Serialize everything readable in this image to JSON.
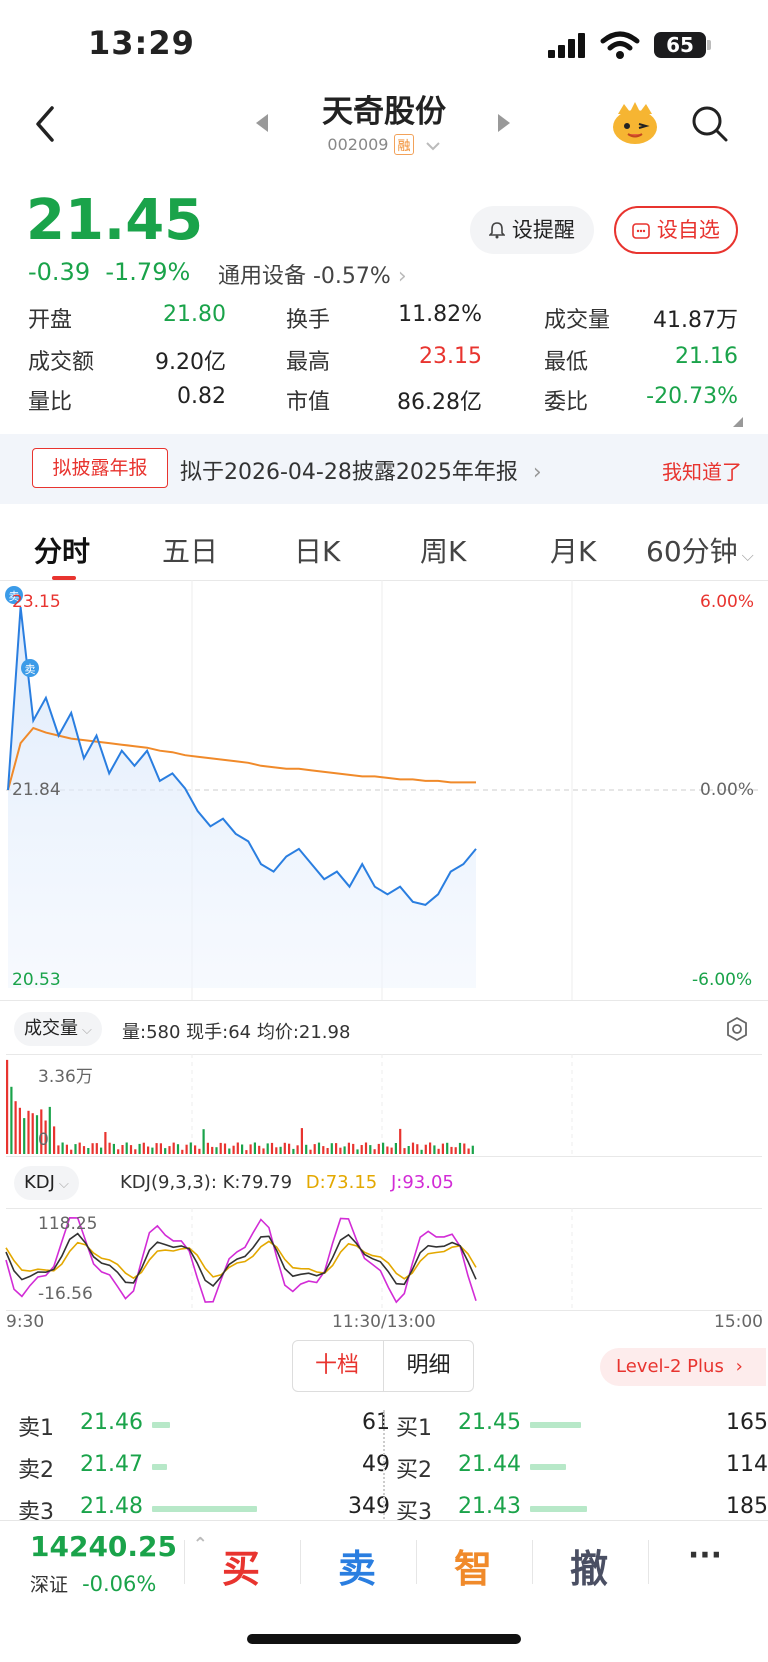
{
  "status": {
    "time": "13:29",
    "battery": "65"
  },
  "header": {
    "title": "天奇股份",
    "code": "002009",
    "tag": "融"
  },
  "quote": {
    "price": "21.45",
    "change": "-0.39",
    "change_pct": "-1.79%",
    "sector": "通用设备 -0.57%",
    "alert_btn": "设提醒",
    "watch_btn": "设自选"
  },
  "stats": [
    {
      "label": "开盘",
      "value": "21.80",
      "color": "#1aa34a"
    },
    {
      "label": "换手",
      "value": "11.82%",
      "color": "#222222"
    },
    {
      "label": "成交量",
      "value": "41.87万",
      "color": "#222222"
    },
    {
      "label": "成交额",
      "value": "9.20亿",
      "color": "#222222"
    },
    {
      "label": "最高",
      "value": "23.15",
      "color": "#e8342f"
    },
    {
      "label": "最低",
      "value": "21.16",
      "color": "#1aa34a"
    },
    {
      "label": "量比",
      "value": "0.82",
      "color": "#222222"
    },
    {
      "label": "市值",
      "value": "86.28亿",
      "color": "#222222"
    },
    {
      "label": "委比",
      "value": "-20.73%",
      "color": "#1aa34a"
    }
  ],
  "notice": {
    "tag": "拟披露年报",
    "text": "拟于2026-04-28披露2025年年报",
    "dismiss": "我知道了"
  },
  "tabs": [
    "分时",
    "五日",
    "日K",
    "周K",
    "月K",
    "60分钟"
  ],
  "chart": {
    "price_high": "23.15",
    "price_mid": "21.84",
    "price_low": "20.53",
    "pct_high": "6.00%",
    "pct_mid": "0.00%",
    "pct_low": "-6.00%",
    "sell_marker": "卖"
  },
  "chart_data": {
    "type": "line",
    "title": "",
    "ylim": [
      20.53,
      23.15
    ],
    "prev_close": 21.84,
    "series": [
      {
        "values": [
          21.84,
          23.05,
          22.3,
          22.45,
          22.2,
          22.35,
          22.05,
          22.2,
          21.95,
          22.1,
          22.0,
          22.1,
          21.9,
          21.95,
          21.85,
          21.7,
          21.6,
          21.65,
          21.55,
          21.5,
          21.35,
          21.3,
          21.4,
          21.45,
          21.35,
          21.25,
          21.3,
          21.2,
          21.35,
          21.2,
          21.15,
          21.2,
          21.1,
          21.08,
          21.15,
          21.3,
          21.35,
          21.45
        ]
      },
      {
        "values": [
          21.84,
          22.15,
          22.25,
          22.22,
          22.2,
          22.18,
          22.17,
          22.16,
          22.15,
          22.14,
          22.13,
          22.12,
          22.1,
          22.09,
          22.07,
          22.06,
          22.05,
          22.04,
          22.03,
          22.02,
          22.0,
          21.99,
          21.98,
          21.98,
          21.97,
          21.96,
          21.95,
          21.94,
          21.93,
          21.93,
          21.92,
          21.91,
          21.91,
          21.9,
          21.9,
          21.89,
          21.89,
          21.89
        ]
      }
    ]
  },
  "volume": {
    "selector": "成交量",
    "info": "量:580  现手:64  均价:21.98",
    "max_label": "3.36万",
    "zero_label": "0"
  },
  "kdj": {
    "selector": "KDJ",
    "params": "KDJ(9,3,3):",
    "k": "K:79.79",
    "d": "D:73.15",
    "j": "J:93.05",
    "top_label": "118.25",
    "bottom_label": "-16.56"
  },
  "time_axis": {
    "start": "9:30",
    "mid": "11:30/13:00",
    "end": "15:00"
  },
  "orderbook": {
    "seg_a": "十档",
    "seg_b": "明细",
    "level2": "Level-2 Plus",
    "sell": [
      {
        "label": "卖1",
        "price": "21.46",
        "vol": "61",
        "bar": 0.06
      },
      {
        "label": "卖2",
        "price": "21.47",
        "vol": "49",
        "bar": 0.05
      },
      {
        "label": "卖3",
        "price": "21.48",
        "vol": "349",
        "bar": 0.35
      }
    ],
    "buy": [
      {
        "label": "买1",
        "price": "21.45",
        "vol": "165",
        "bar": 0.17
      },
      {
        "label": "买2",
        "price": "21.44",
        "vol": "114",
        "bar": 0.12
      },
      {
        "label": "买3",
        "price": "21.43",
        "vol": "185",
        "bar": 0.19
      }
    ]
  },
  "bottom": {
    "index_value": "14240.25",
    "index_name": "深证",
    "index_change": "-0.06%",
    "actions": [
      "买",
      "卖",
      "智",
      "撤",
      "···"
    ]
  }
}
